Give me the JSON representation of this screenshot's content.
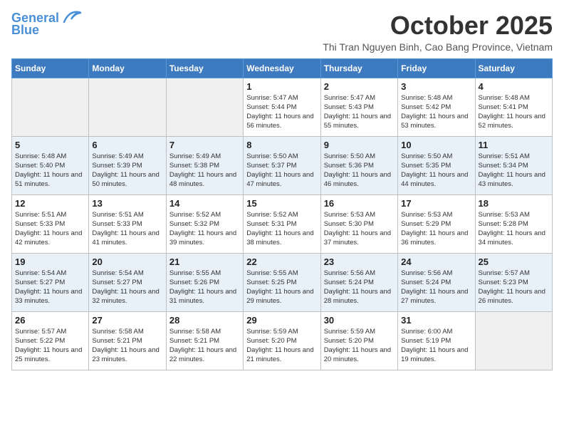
{
  "header": {
    "logo_general": "General",
    "logo_blue": "Blue",
    "title": "October 2025",
    "subtitle": "Thi Tran Nguyen Binh, Cao Bang Province, Vietnam"
  },
  "days_of_week": [
    "Sunday",
    "Monday",
    "Tuesday",
    "Wednesday",
    "Thursday",
    "Friday",
    "Saturday"
  ],
  "weeks": [
    [
      {
        "day": "",
        "empty": true
      },
      {
        "day": "",
        "empty": true
      },
      {
        "day": "",
        "empty": true
      },
      {
        "day": "1",
        "sunrise": "Sunrise: 5:47 AM",
        "sunset": "Sunset: 5:44 PM",
        "daylight": "Daylight: 11 hours and 56 minutes."
      },
      {
        "day": "2",
        "sunrise": "Sunrise: 5:47 AM",
        "sunset": "Sunset: 5:43 PM",
        "daylight": "Daylight: 11 hours and 55 minutes."
      },
      {
        "day": "3",
        "sunrise": "Sunrise: 5:48 AM",
        "sunset": "Sunset: 5:42 PM",
        "daylight": "Daylight: 11 hours and 53 minutes."
      },
      {
        "day": "4",
        "sunrise": "Sunrise: 5:48 AM",
        "sunset": "Sunset: 5:41 PM",
        "daylight": "Daylight: 11 hours and 52 minutes."
      }
    ],
    [
      {
        "day": "5",
        "sunrise": "Sunrise: 5:48 AM",
        "sunset": "Sunset: 5:40 PM",
        "daylight": "Daylight: 11 hours and 51 minutes."
      },
      {
        "day": "6",
        "sunrise": "Sunrise: 5:49 AM",
        "sunset": "Sunset: 5:39 PM",
        "daylight": "Daylight: 11 hours and 50 minutes."
      },
      {
        "day": "7",
        "sunrise": "Sunrise: 5:49 AM",
        "sunset": "Sunset: 5:38 PM",
        "daylight": "Daylight: 11 hours and 48 minutes."
      },
      {
        "day": "8",
        "sunrise": "Sunrise: 5:50 AM",
        "sunset": "Sunset: 5:37 PM",
        "daylight": "Daylight: 11 hours and 47 minutes."
      },
      {
        "day": "9",
        "sunrise": "Sunrise: 5:50 AM",
        "sunset": "Sunset: 5:36 PM",
        "daylight": "Daylight: 11 hours and 46 minutes."
      },
      {
        "day": "10",
        "sunrise": "Sunrise: 5:50 AM",
        "sunset": "Sunset: 5:35 PM",
        "daylight": "Daylight: 11 hours and 44 minutes."
      },
      {
        "day": "11",
        "sunrise": "Sunrise: 5:51 AM",
        "sunset": "Sunset: 5:34 PM",
        "daylight": "Daylight: 11 hours and 43 minutes."
      }
    ],
    [
      {
        "day": "12",
        "sunrise": "Sunrise: 5:51 AM",
        "sunset": "Sunset: 5:33 PM",
        "daylight": "Daylight: 11 hours and 42 minutes."
      },
      {
        "day": "13",
        "sunrise": "Sunrise: 5:51 AM",
        "sunset": "Sunset: 5:33 PM",
        "daylight": "Daylight: 11 hours and 41 minutes."
      },
      {
        "day": "14",
        "sunrise": "Sunrise: 5:52 AM",
        "sunset": "Sunset: 5:32 PM",
        "daylight": "Daylight: 11 hours and 39 minutes."
      },
      {
        "day": "15",
        "sunrise": "Sunrise: 5:52 AM",
        "sunset": "Sunset: 5:31 PM",
        "daylight": "Daylight: 11 hours and 38 minutes."
      },
      {
        "day": "16",
        "sunrise": "Sunrise: 5:53 AM",
        "sunset": "Sunset: 5:30 PM",
        "daylight": "Daylight: 11 hours and 37 minutes."
      },
      {
        "day": "17",
        "sunrise": "Sunrise: 5:53 AM",
        "sunset": "Sunset: 5:29 PM",
        "daylight": "Daylight: 11 hours and 36 minutes."
      },
      {
        "day": "18",
        "sunrise": "Sunrise: 5:53 AM",
        "sunset": "Sunset: 5:28 PM",
        "daylight": "Daylight: 11 hours and 34 minutes."
      }
    ],
    [
      {
        "day": "19",
        "sunrise": "Sunrise: 5:54 AM",
        "sunset": "Sunset: 5:27 PM",
        "daylight": "Daylight: 11 hours and 33 minutes."
      },
      {
        "day": "20",
        "sunrise": "Sunrise: 5:54 AM",
        "sunset": "Sunset: 5:27 PM",
        "daylight": "Daylight: 11 hours and 32 minutes."
      },
      {
        "day": "21",
        "sunrise": "Sunrise: 5:55 AM",
        "sunset": "Sunset: 5:26 PM",
        "daylight": "Daylight: 11 hours and 31 minutes."
      },
      {
        "day": "22",
        "sunrise": "Sunrise: 5:55 AM",
        "sunset": "Sunset: 5:25 PM",
        "daylight": "Daylight: 11 hours and 29 minutes."
      },
      {
        "day": "23",
        "sunrise": "Sunrise: 5:56 AM",
        "sunset": "Sunset: 5:24 PM",
        "daylight": "Daylight: 11 hours and 28 minutes."
      },
      {
        "day": "24",
        "sunrise": "Sunrise: 5:56 AM",
        "sunset": "Sunset: 5:24 PM",
        "daylight": "Daylight: 11 hours and 27 minutes."
      },
      {
        "day": "25",
        "sunrise": "Sunrise: 5:57 AM",
        "sunset": "Sunset: 5:23 PM",
        "daylight": "Daylight: 11 hours and 26 minutes."
      }
    ],
    [
      {
        "day": "26",
        "sunrise": "Sunrise: 5:57 AM",
        "sunset": "Sunset: 5:22 PM",
        "daylight": "Daylight: 11 hours and 25 minutes."
      },
      {
        "day": "27",
        "sunrise": "Sunrise: 5:58 AM",
        "sunset": "Sunset: 5:21 PM",
        "daylight": "Daylight: 11 hours and 23 minutes."
      },
      {
        "day": "28",
        "sunrise": "Sunrise: 5:58 AM",
        "sunset": "Sunset: 5:21 PM",
        "daylight": "Daylight: 11 hours and 22 minutes."
      },
      {
        "day": "29",
        "sunrise": "Sunrise: 5:59 AM",
        "sunset": "Sunset: 5:20 PM",
        "daylight": "Daylight: 11 hours and 21 minutes."
      },
      {
        "day": "30",
        "sunrise": "Sunrise: 5:59 AM",
        "sunset": "Sunset: 5:20 PM",
        "daylight": "Daylight: 11 hours and 20 minutes."
      },
      {
        "day": "31",
        "sunrise": "Sunrise: 6:00 AM",
        "sunset": "Sunset: 5:19 PM",
        "daylight": "Daylight: 11 hours and 19 minutes."
      },
      {
        "day": "",
        "empty": true
      }
    ]
  ]
}
